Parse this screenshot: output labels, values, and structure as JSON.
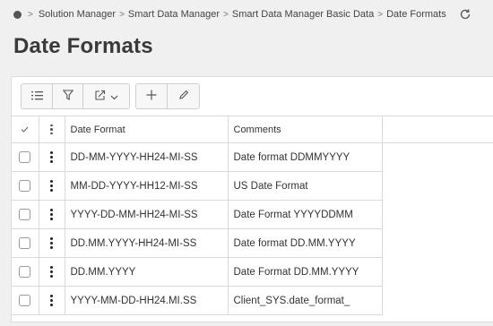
{
  "breadcrumb": {
    "items": [
      "Solution Manager",
      "Smart Data Manager",
      "Smart Data Manager Basic Data",
      "Date Formats"
    ],
    "home_icon": "home-dot-icon",
    "refresh_icon": "refresh-icon"
  },
  "page": {
    "title": "Date Formats"
  },
  "toolbar": {
    "buttons": [
      "list-icon",
      "filter-icon",
      "export-icon",
      "add-icon",
      "edit-icon"
    ]
  },
  "table": {
    "columns": [
      "Date Format",
      "Comments"
    ],
    "rows": [
      {
        "date_format": "DD-MM-YYYY-HH24-MI-SS",
        "comments": "Date format DDMMYYYY"
      },
      {
        "date_format": "MM-DD-YYYY-HH12-MI-SS",
        "comments": "US Date Format"
      },
      {
        "date_format": "YYYY-DD-MM-HH24-MI-SS",
        "comments": "Date Format YYYYDDMM"
      },
      {
        "date_format": "DD.MM.YYYY-HH24-MI-SS",
        "comments": "Date format DD.MM.YYYY"
      },
      {
        "date_format": "DD.MM.YYYY",
        "comments": "Date Format DD.MM.YYYY"
      },
      {
        "date_format": "YYYY-MM-DD-HH24.MI.SS",
        "comments": "Client_SYS.date_format_"
      }
    ]
  }
}
